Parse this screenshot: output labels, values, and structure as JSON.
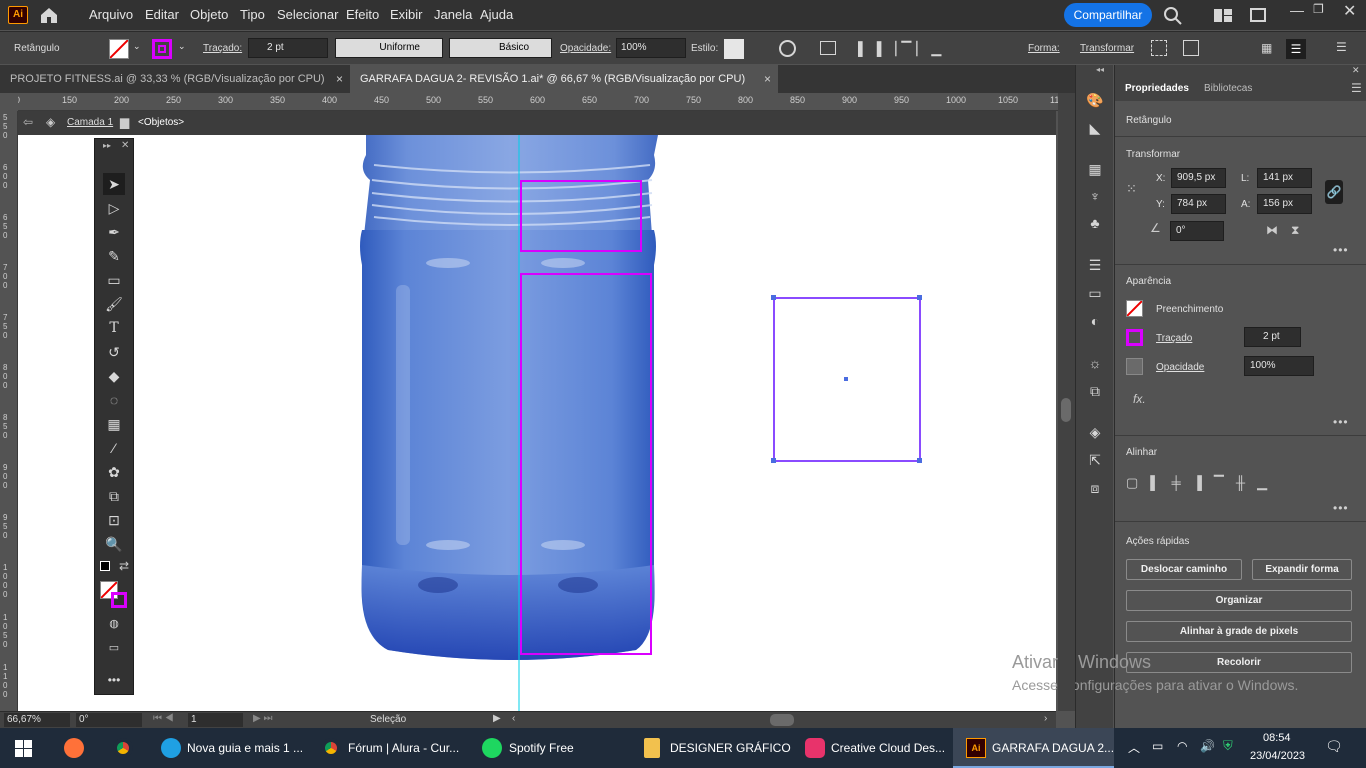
{
  "menu": {
    "items": [
      "Arquivo",
      "Editar",
      "Objeto",
      "Tipo",
      "Selecionar",
      "Efeito",
      "Exibir",
      "Janela",
      "Ajuda"
    ],
    "app_logo": "Ai",
    "share": "Compartilhar"
  },
  "control": {
    "object_type": "Retângulo",
    "stroke_label": "Traçado:",
    "stroke_weight": "2 pt",
    "profile": "Uniforme",
    "brush": "Básico",
    "opacity_label": "Opacidade:",
    "opacity": "100%",
    "style_label": "Estilo:",
    "shape_label": "Forma:",
    "transform_label": "Transformar"
  },
  "tabs": [
    {
      "label": "PROJETO FITNESS.ai @ 33,33 % (RGB/Visualização por CPU)",
      "close": "×"
    },
    {
      "label": "GARRAFA DAGUA 2- REVISÃO 1.ai* @ 66,67 % (RGB/Visualização por CPU)",
      "close": "×"
    }
  ],
  "ruler": {
    "h_ticks": [
      "00",
      "150",
      "200",
      "250",
      "300",
      "350",
      "400",
      "450",
      "500",
      "550",
      "600",
      "650",
      "700",
      "750",
      "800",
      "850",
      "900",
      "950",
      "1000",
      "1050",
      "11"
    ],
    "v_ticks": [
      "5\n5\n0",
      "6\n0\n0",
      "6\n5\n0",
      "7\n0\n0",
      "7\n5\n0",
      "8\n0\n0",
      "8\n5\n0",
      "9\n0\n0",
      "9\n5\n0",
      "1\n0\n0\n0",
      "1\n0\n5\n0",
      "1\n1\n0\n0"
    ]
  },
  "breadcrumb": {
    "layer": "Camada 1",
    "group": "<Objetos>"
  },
  "properties": {
    "tab_active": "Propriedades",
    "tab_other": "Bibliotecas",
    "object_type": "Retângulo",
    "transform_title": "Transformar",
    "x_label": "X:",
    "x": "909,5 px",
    "y_label": "Y:",
    "y": "784 px",
    "w_label": "L:",
    "w": "141 px",
    "h_label": "A:",
    "h": "156 px",
    "angle": "0°",
    "appearance_title": "Aparência",
    "fill_label": "Preenchimento",
    "stroke_label": "Traçado",
    "stroke_weight": "2 pt",
    "opacity_label": "Opacidade",
    "opacity": "100%",
    "fx": "fx.",
    "align_title": "Alinhar",
    "quick_actions_title": "Ações rápidas",
    "btn_offset": "Deslocar caminho",
    "btn_expand": "Expandir forma",
    "btn_arrange": "Organizar",
    "btn_pixel_grid": "Alinhar à grade de pixels",
    "btn_recolor": "Recolorir",
    "more": "•••"
  },
  "status": {
    "zoom": "66,67%",
    "rotation": "0°",
    "artboard": "1",
    "tool": "Seleção"
  },
  "watermark": {
    "line1": "Ativar o Windows",
    "line2": "Acesse Configurações para ativar o Windows."
  },
  "taskbar": {
    "items": [
      {
        "label": "Nova guia e mais 1 ..."
      },
      {
        "label": "Fórum | Alura - Cur..."
      },
      {
        "label": "Spotify Free"
      },
      {
        "label": "DESIGNER GRÁFICO"
      },
      {
        "label": "Creative Cloud Des..."
      },
      {
        "label": "GARRAFA DAGUA 2..."
      }
    ],
    "time": "08:54",
    "date": "23/04/2023"
  },
  "colors": {
    "accent": "#1473e6",
    "selection": "#d900ff",
    "bounding": "#8a4bff",
    "bottle": "#3a66c4"
  }
}
